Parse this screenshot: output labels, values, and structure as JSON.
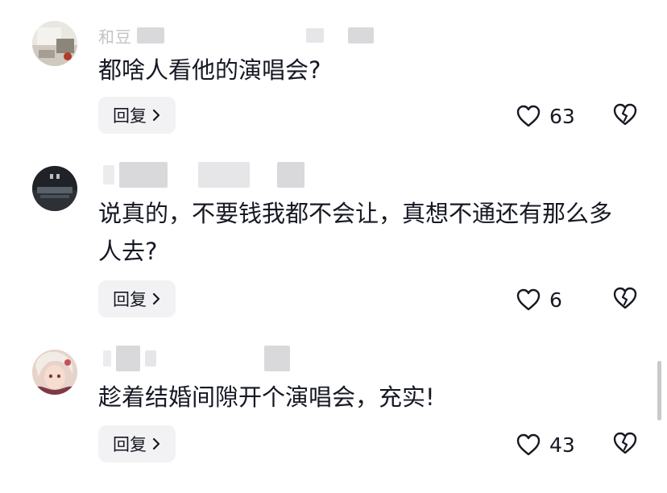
{
  "comments": [
    {
      "username": "和豆",
      "text": "都啥人看他的演唱会?",
      "reply_label": "回复",
      "likes": "63",
      "avatar": "avatar-photo"
    },
    {
      "username": "",
      "text": "说真的，不要钱我都不会让，真想不通还有那么多人去?",
      "reply_label": "回复",
      "likes": "6",
      "avatar": "avatar-photo"
    },
    {
      "username": "",
      "text": "趁着结婚间隙开个演唱会，充实!",
      "reply_label": "回复",
      "likes": "43",
      "avatar": "avatar-anime"
    }
  ],
  "icons": {
    "like": "heart-outline-icon",
    "dislike": "broken-heart-icon",
    "reply_arrow": "chevron-right-icon"
  },
  "colors": {
    "text": "#161823",
    "reply_bg": "#f2f2f4",
    "muted": "#9a9aa0"
  }
}
